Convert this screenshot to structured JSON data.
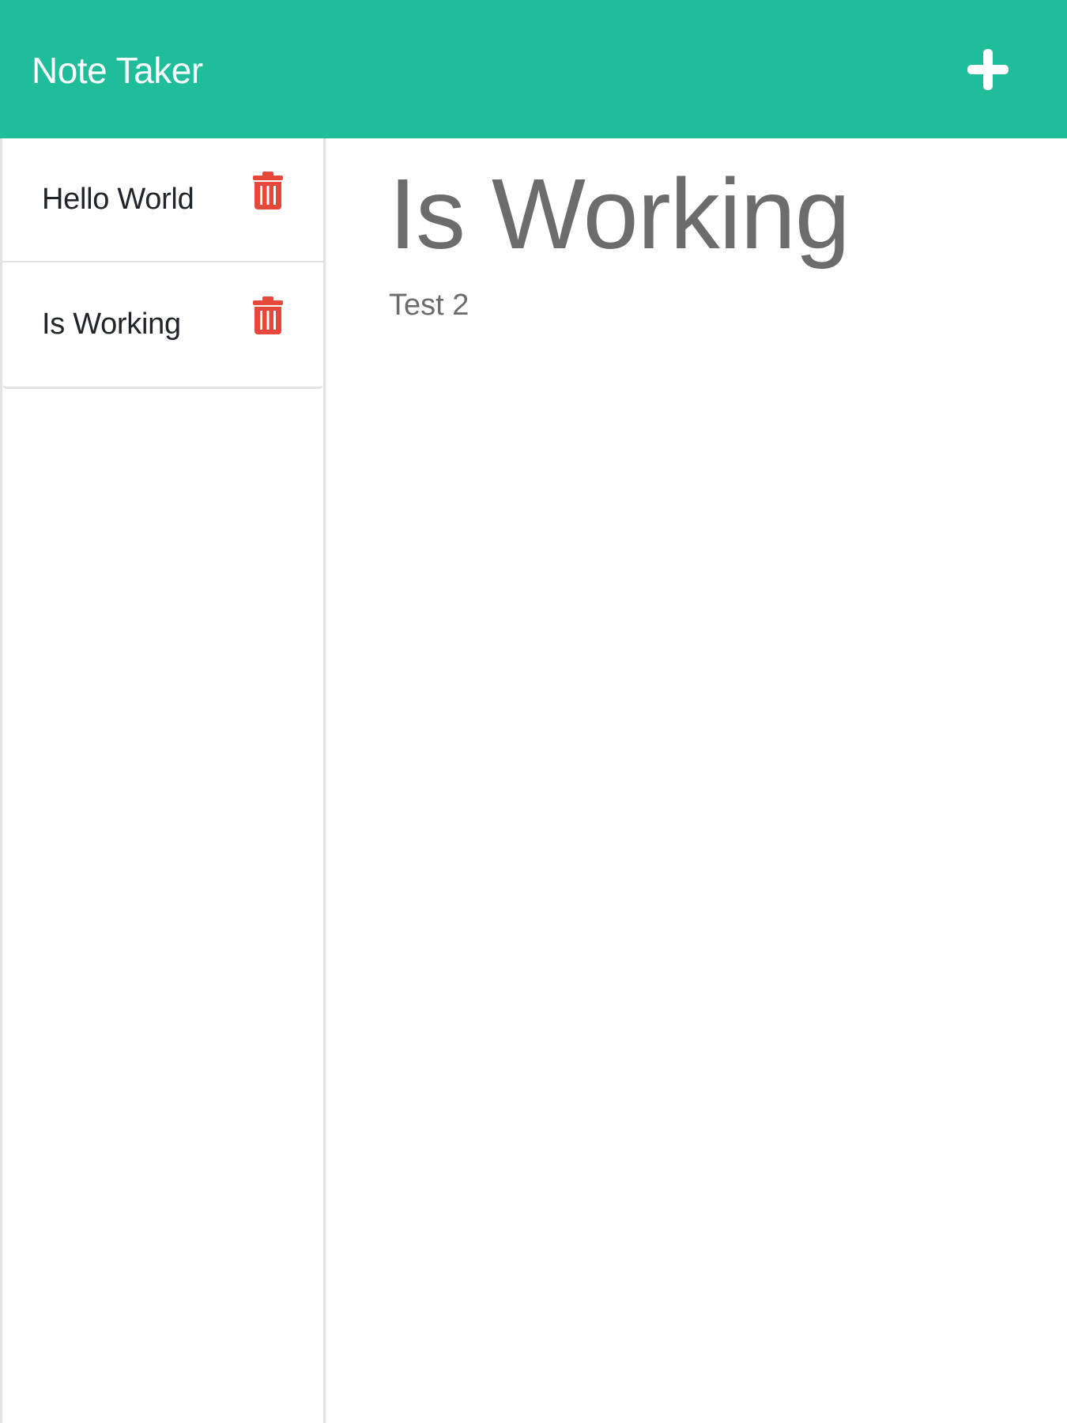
{
  "app": {
    "title": "Note Taker",
    "new_note_icon": "plus-icon",
    "colors": {
      "accent": "#20bd9b",
      "delete": "#e8483c",
      "text_dark": "#212529",
      "text_muted": "#6c6c6c"
    }
  },
  "sidebar": {
    "notes": [
      {
        "title": "Hello World",
        "icon": "trash-icon"
      },
      {
        "title": "Is Working",
        "icon": "trash-icon"
      }
    ]
  },
  "main": {
    "note_title": "Is Working",
    "note_text": "Test 2"
  }
}
